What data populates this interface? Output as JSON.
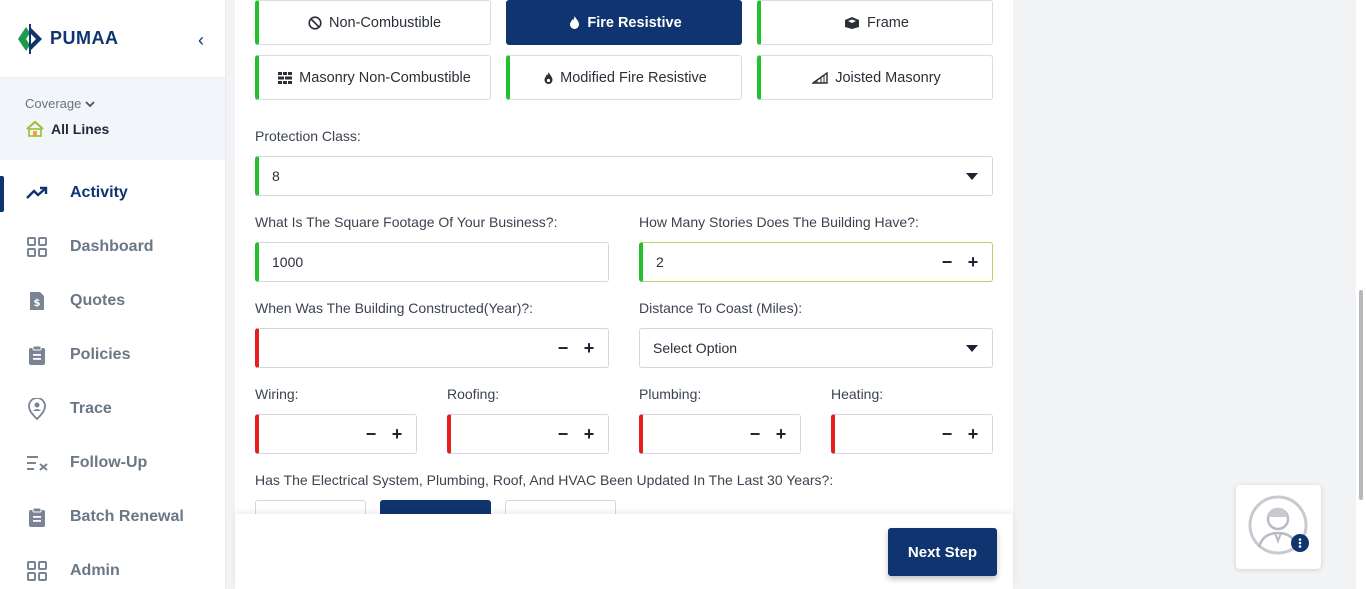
{
  "app": {
    "name": "PUMAA"
  },
  "coverage": {
    "label": "Coverage",
    "value": "All Lines"
  },
  "nav": [
    {
      "label": "Activity",
      "icon": "trending-up-icon",
      "active": true
    },
    {
      "label": "Dashboard",
      "icon": "grid-icon",
      "active": false
    },
    {
      "label": "Quotes",
      "icon": "dollar-document-icon",
      "active": false
    },
    {
      "label": "Policies",
      "icon": "clipboard-icon",
      "active": false
    },
    {
      "label": "Trace",
      "icon": "location-person-icon",
      "active": false
    },
    {
      "label": "Follow-Up",
      "icon": "list-check-icon",
      "active": false
    },
    {
      "label": "Batch Renewal",
      "icon": "clipboard-icon",
      "active": false
    },
    {
      "label": "Admin",
      "icon": "grid-icon",
      "active": false
    }
  ],
  "construction": [
    {
      "label": "Non-Combustible",
      "icon": "ban-icon",
      "selected": false
    },
    {
      "label": "Fire Resistive",
      "icon": "fire-icon",
      "selected": true
    },
    {
      "label": "Frame",
      "icon": "frame-icon",
      "selected": false
    },
    {
      "label": "Masonry Non-Combustible",
      "icon": "brick-icon",
      "selected": false
    },
    {
      "label": "Modified Fire Resistive",
      "icon": "flame-icon",
      "selected": false
    },
    {
      "label": "Joisted Masonry",
      "icon": "joist-icon",
      "selected": false
    }
  ],
  "form": {
    "protection_class": {
      "label": "Protection Class:",
      "value": "8"
    },
    "square_footage": {
      "label": "What Is The Square Footage Of Your Business?:",
      "value": "1000"
    },
    "stories": {
      "label": "How Many Stories Does The Building Have?:",
      "value": "2"
    },
    "year_built": {
      "label": "When Was The Building Constructed(Year)?:",
      "value": ""
    },
    "distance_coast": {
      "label": "Distance To Coast (Miles):",
      "value": "Select Option"
    },
    "wiring": {
      "label": "Wiring:",
      "value": ""
    },
    "roofing": {
      "label": "Roofing:",
      "value": ""
    },
    "plumbing": {
      "label": "Plumbing:",
      "value": ""
    },
    "heating": {
      "label": "Heating:",
      "value": ""
    },
    "updated_question": {
      "label": "Has The Electrical System, Plumbing, Roof, And HVAC Been Updated In The Last 30 Years?:"
    }
  },
  "stepper": {
    "minus": "−",
    "plus": "+"
  },
  "footer": {
    "next_label": "Next Step"
  },
  "colors": {
    "primary": "#0f3470",
    "valid": "#22c02e",
    "invalid": "#e61e1e"
  }
}
